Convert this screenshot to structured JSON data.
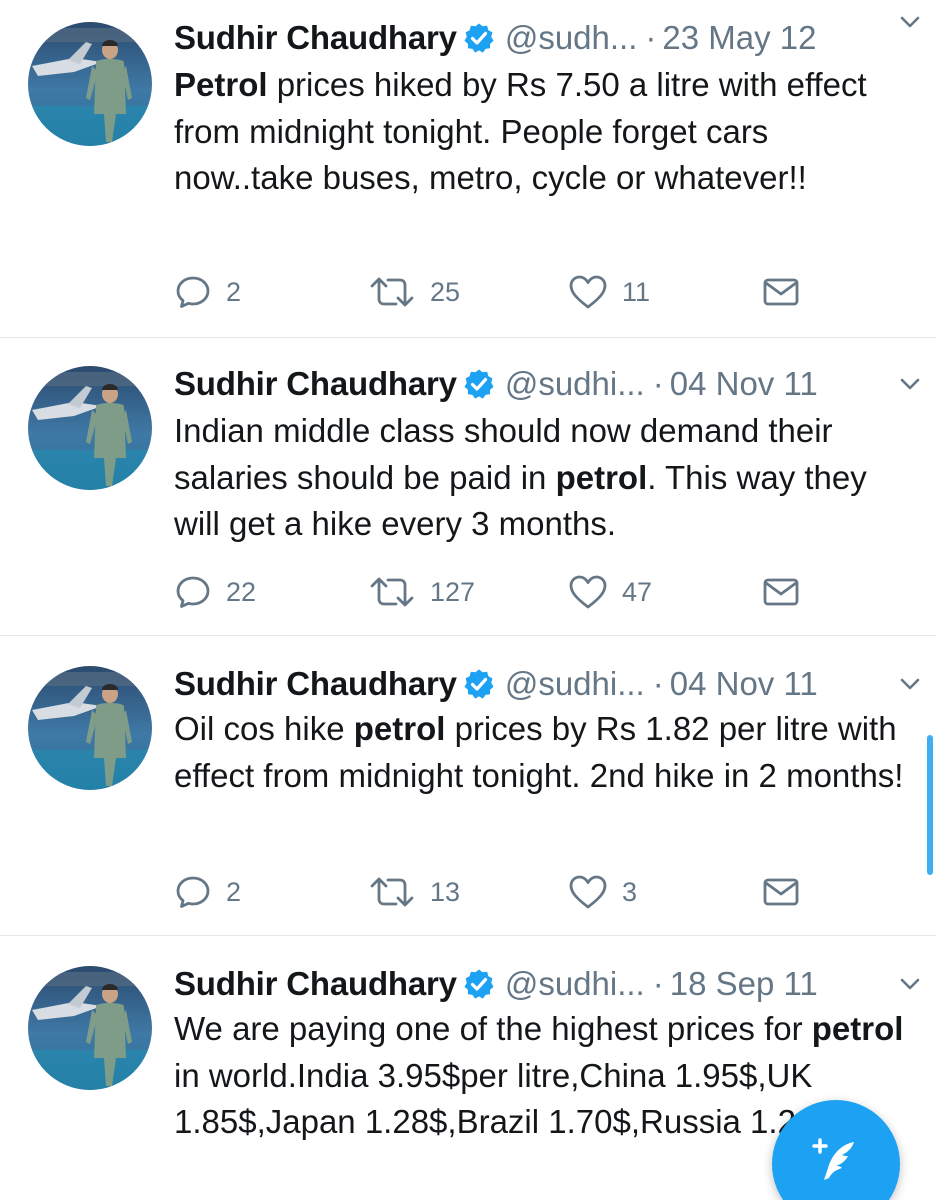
{
  "tweets": [
    {
      "name": "Sudhir Chaudhary",
      "handle": "@sudh...",
      "separator": "·",
      "date": "23 May 12",
      "text": [
        {
          "t": "Petrol",
          "b": true
        },
        {
          "t": " prices hiked by Rs 7.50 a litre with effect from midnight tonight. People forget cars now..take buses, metro, cycle or whatever!!",
          "b": false
        }
      ],
      "replies": "2",
      "retweets": "25",
      "likes": "11"
    },
    {
      "name": "Sudhir Chaudhary",
      "handle": "@sudhi...",
      "separator": "·",
      "date": "04 Nov 11",
      "text": [
        {
          "t": "Indian middle class should now demand their salaries should be paid in ",
          "b": false
        },
        {
          "t": "petrol",
          "b": true
        },
        {
          "t": ". This way they will get a hike every 3 months.",
          "b": false
        }
      ],
      "replies": "22",
      "retweets": "127",
      "likes": "47"
    },
    {
      "name": "Sudhir Chaudhary",
      "handle": "@sudhi...",
      "separator": "·",
      "date": "04 Nov 11",
      "text": [
        {
          "t": "Oil cos hike ",
          "b": false
        },
        {
          "t": "petrol",
          "b": true
        },
        {
          "t": " prices by Rs 1.82 per litre with effect from midnight tonight. 2nd hike in 2 months!",
          "b": false
        }
      ],
      "replies": "2",
      "retweets": "13",
      "likes": "3"
    },
    {
      "name": "Sudhir Chaudhary",
      "handle": "@sudhi...",
      "separator": "·",
      "date": "18 Sep 11",
      "text": [
        {
          "t": "We are paying one of the highest prices for ",
          "b": false
        },
        {
          "t": "petrol",
          "b": true
        },
        {
          "t": " in world.India 3.95$per litre,China 1.95$,UK 1.85$,Japan 1.28$,Brazil 1.70$,Russia 1.26$",
          "b": false
        }
      ]
    }
  ],
  "icons": {
    "reply": "reply-icon",
    "retweet": "retweet-icon",
    "like": "heart-icon",
    "dm": "envelope-icon",
    "verified": "verified-badge-icon",
    "caret": "chevron-down-icon",
    "compose": "compose-tweet-icon"
  },
  "colors": {
    "accent": "#1da1f2",
    "text": "#14171a",
    "muted": "#657786",
    "divider": "#e1e8ed"
  }
}
